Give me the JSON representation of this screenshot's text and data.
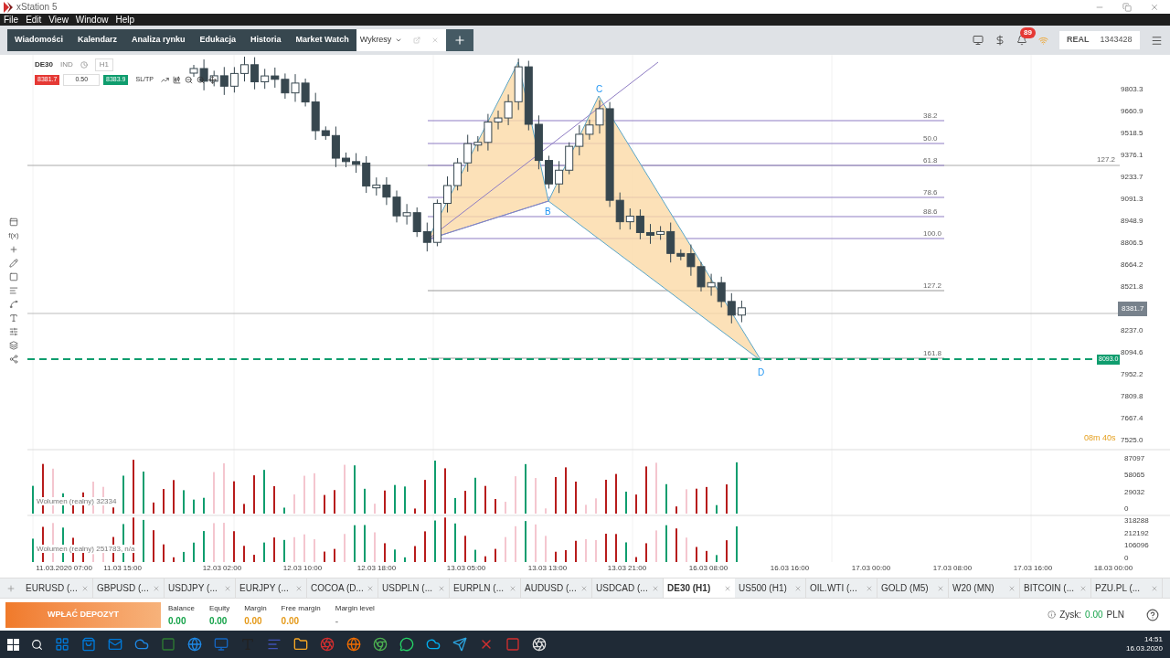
{
  "window": {
    "title": "xStation 5"
  },
  "menu": [
    "File",
    "Edit",
    "View",
    "Window",
    "Help"
  ],
  "nav_tabs": [
    {
      "label": "Wiadomości",
      "selected": false
    },
    {
      "label": "Kalendarz",
      "selected": false
    },
    {
      "label": "Analiza rynku",
      "selected": false
    },
    {
      "label": "Edukacja",
      "selected": false
    },
    {
      "label": "Historia",
      "selected": false
    },
    {
      "label": "Market Watch",
      "selected": false
    },
    {
      "label": "Wykresy",
      "selected": true
    }
  ],
  "notifications": {
    "badge": "89"
  },
  "account": {
    "type": "REAL",
    "number": "1343428"
  },
  "chart": {
    "symbol": "DE30",
    "market": "IND",
    "timeframe": "H1",
    "sell": "8381.7",
    "volume": "0.50",
    "buy": "8383.9",
    "sltp": "SL/TP",
    "toolbar_text": "f(x)",
    "fib_levels": [
      "38.2",
      "50.0",
      "61.8",
      "78.6",
      "88.6",
      "100.0",
      "127.2",
      "161.8"
    ],
    "fib_extra": "127.2",
    "pattern_points": [
      "B",
      "C",
      "D"
    ],
    "price_axis": [
      {
        "kind": "tick",
        "label": "9803.3"
      },
      {
        "kind": "tick",
        "label": "9660.9"
      },
      {
        "kind": "tick",
        "label": "9518.5"
      },
      {
        "kind": "tick",
        "label": "9376.1"
      },
      {
        "kind": "tick",
        "label": "9233.7"
      },
      {
        "kind": "tick",
        "label": "9091.3"
      },
      {
        "kind": "tick",
        "label": "8948.9"
      },
      {
        "kind": "tick",
        "label": "8806.5"
      },
      {
        "kind": "tick",
        "label": "8664.2"
      },
      {
        "kind": "tick",
        "label": "8521.8"
      },
      {
        "kind": "current",
        "label": "8381.7"
      },
      {
        "kind": "tick",
        "label": "8237.0"
      },
      {
        "kind": "tick",
        "label": "8094.6"
      },
      {
        "kind": "tick",
        "label": "7952.2"
      },
      {
        "kind": "tick",
        "label": "7809.8"
      },
      {
        "kind": "tick",
        "label": "7667.4"
      },
      {
        "kind": "tick",
        "label": "7525.0"
      }
    ],
    "order_level": "8093.0",
    "timer": "08m 40s",
    "volume_panels": [
      {
        "label": "Wolumen (realny) 32334",
        "axis": [
          "87097",
          "58065",
          "29032",
          "0"
        ]
      },
      {
        "label": "Wolumen (realny) 251783, n/a",
        "axis": [
          "318288",
          "212192",
          "106096",
          "0"
        ]
      }
    ],
    "time_axis": [
      "11.03.2020 07:00",
      "11.03 15:00",
      "12.03 02:00",
      "12.03 10:00",
      "12.03 18:00",
      "13.03 05:00",
      "13.03 13:00",
      "13.03 21:00",
      "16.03 08:00",
      "16.03 16:00",
      "17.03 00:00",
      "17.03 08:00",
      "17.03 16:00",
      "18.03 00:00"
    ]
  },
  "instrument_tabs": [
    {
      "label": "EURUSD (...",
      "selected": false
    },
    {
      "label": "GBPUSD (...",
      "selected": false
    },
    {
      "label": "USDJPY (...",
      "selected": false
    },
    {
      "label": "EURJPY (...",
      "selected": false
    },
    {
      "label": "COCOA (D...",
      "selected": false
    },
    {
      "label": "USDPLN (...",
      "selected": false
    },
    {
      "label": "EURPLN (...",
      "selected": false
    },
    {
      "label": "AUDUSD (...",
      "selected": false
    },
    {
      "label": "USDCAD (...",
      "selected": false
    },
    {
      "label": "DE30 (H1)",
      "selected": true
    },
    {
      "label": "US500 (H1)",
      "selected": false
    },
    {
      "label": "OIL.WTI (...",
      "selected": false
    },
    {
      "label": "GOLD (M5)",
      "selected": false
    },
    {
      "label": "W20 (MN)",
      "selected": false
    },
    {
      "label": "BITCOIN (...",
      "selected": false
    },
    {
      "label": "PZU.PL (...",
      "selected": false
    }
  ],
  "footer": {
    "deposit_button": "WPŁAĆ DEPOZYT",
    "stats": [
      {
        "label": "Balance",
        "value": "0.00",
        "color": "#16a34a"
      },
      {
        "label": "Equity",
        "value": "0.00",
        "color": "#16a34a"
      },
      {
        "label": "Margin",
        "value": "0.00",
        "color": "#e59a1a"
      },
      {
        "label": "Free margin",
        "value": "0.00",
        "color": "#e59a1a"
      },
      {
        "label": "Margin level",
        "value": "-"
      }
    ],
    "profit": {
      "label": "Zysk:",
      "value": "0.00",
      "currency": "PLN"
    }
  },
  "taskbar": {
    "time": "14:51",
    "date": "16.03.2020"
  }
}
